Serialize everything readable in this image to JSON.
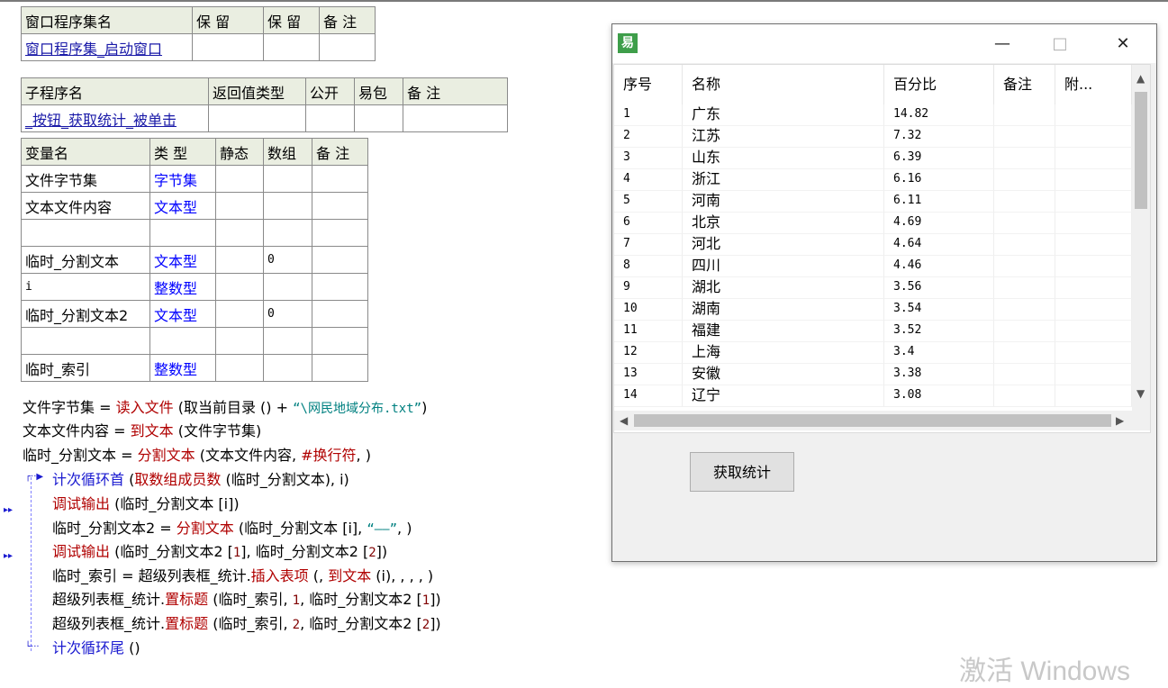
{
  "window_program_table": {
    "headers": [
      "窗口程序集名",
      "保 留",
      "保 留",
      "备 注"
    ],
    "row": [
      "窗口程序集_启动窗口",
      "",
      "",
      ""
    ]
  },
  "subroutine_table": {
    "headers": [
      "子程序名",
      "返回值类型",
      "公开",
      "易包",
      "备 注"
    ],
    "row": [
      "_按钮_获取统计_被单击",
      "",
      "",
      "",
      ""
    ]
  },
  "variable_table": {
    "headers": [
      "变量名",
      "类 型",
      "静态",
      "数组",
      "备 注"
    ],
    "rows": [
      [
        "文件字节集",
        "字节集",
        "",
        "",
        ""
      ],
      [
        "文本文件内容",
        "文本型",
        "",
        "",
        ""
      ],
      [
        "",
        "",
        "",
        "",
        ""
      ],
      [
        "临时_分割文本",
        "文本型",
        "",
        "0",
        ""
      ],
      [
        "i",
        "整数型",
        "",
        "",
        ""
      ],
      [
        "临时_分割文本2",
        "文本型",
        "",
        "0",
        ""
      ],
      [
        "",
        "",
        "",
        "",
        ""
      ],
      [
        "临时_索引",
        "整数型",
        "",
        "",
        ""
      ]
    ]
  },
  "code": {
    "l1": {
      "a": "文件字节集 = ",
      "b": "读入文件",
      "c": " (取当前目录 () + ",
      "d": "“\\网民地域分布.txt”",
      "e": ")"
    },
    "l2": {
      "a": "文本文件内容 = ",
      "b": "到文本",
      "c": " (文件字节集)"
    },
    "l3": {
      "a": "临时_分割文本 = ",
      "b": "分割文本",
      "c": " (文本文件内容, ",
      "d": "#换行符",
      "e": ", )"
    },
    "l4": {
      "a": "计次循环首",
      "b": " (",
      "c": "取数组成员数",
      "d": " (临时_分割文本), i)"
    },
    "l5": {
      "a": "调试输出",
      "b": " (临时_分割文本 [i])"
    },
    "l6": {
      "a": "临时_分割文本2 = ",
      "b": "分割文本",
      "c": " (临时_分割文本 [i], ",
      "d": "“——”",
      "e": ", )"
    },
    "l7": {
      "a": "调试输出",
      "b": " (临时_分割文本2 [",
      "c": "1",
      "d": "], 临时_分割文本2 [",
      "e": "2",
      "f": "])"
    },
    "l8": {
      "a": "临时_索引 = 超级列表框_统计.",
      "b": "插入表项",
      "c": " (, ",
      "d": "到文本",
      "e": " (i), , , , )"
    },
    "l9": {
      "a": "超级列表框_统计.",
      "b": "置标题",
      "c": " (临时_索引, ",
      "d": "1",
      "e": ", 临时_分割文本2 [",
      "f": "1",
      "g": "])"
    },
    "l10": {
      "a": "超级列表框_统计.",
      "b": "置标题",
      "c": " (临时_索引, ",
      "d": "2",
      "e": ", 临时_分割文本2 [",
      "f": "2",
      "g": "])"
    },
    "l11": {
      "a": "计次循环尾",
      "b": " ()"
    }
  },
  "app_window": {
    "icon": "易",
    "minimize": "—",
    "maximize": "□",
    "close": "✕",
    "list": {
      "columns": [
        "序号",
        "名称",
        "百分比",
        "备注",
        "附..."
      ],
      "rows": [
        [
          "1",
          "广东",
          "14.82"
        ],
        [
          "2",
          "江苏",
          "7.32"
        ],
        [
          "3",
          "山东",
          "6.39"
        ],
        [
          "4",
          "浙江",
          "6.16"
        ],
        [
          "5",
          "河南",
          "6.11"
        ],
        [
          "6",
          "北京",
          "4.69"
        ],
        [
          "7",
          "河北",
          "4.64"
        ],
        [
          "8",
          "四川",
          "4.46"
        ],
        [
          "9",
          "湖北",
          "3.56"
        ],
        [
          "10",
          "湖南",
          "3.54"
        ],
        [
          "11",
          "福建",
          "3.52"
        ],
        [
          "12",
          "上海",
          "3.4"
        ],
        [
          "13",
          "安徽",
          "3.38"
        ],
        [
          "14",
          "辽宁",
          "3.08"
        ]
      ]
    },
    "button_label": "获取统计"
  },
  "watermark": "激活 Windows"
}
